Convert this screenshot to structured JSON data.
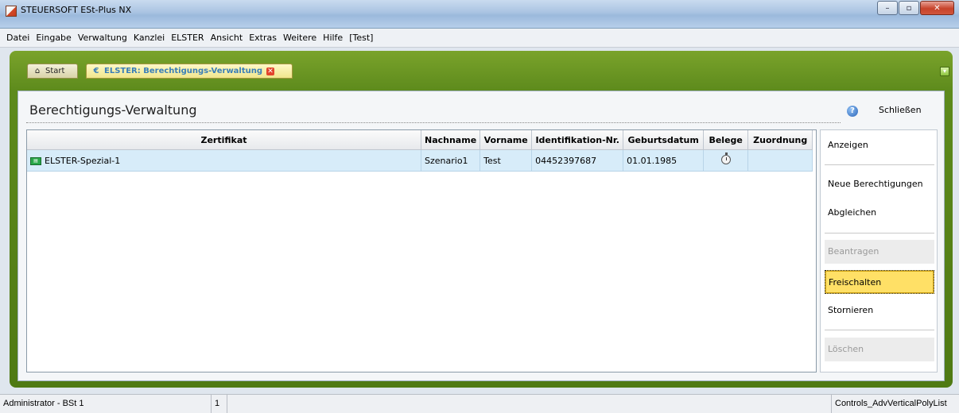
{
  "window": {
    "title": "STEUERSOFT ESt-Plus NX",
    "minimize": "–",
    "maximize": "▫",
    "close": "✕"
  },
  "menu": {
    "items": [
      "Datei",
      "Eingabe",
      "Verwaltung",
      "Kanzlei",
      "ELSTER",
      "Ansicht",
      "Extras",
      "Weitere",
      "Hilfe",
      "[Test]"
    ]
  },
  "tabs": [
    {
      "label": "Start",
      "icon": "start-icon"
    },
    {
      "label": "ELSTER: Berechtigungs-Verwaltung",
      "icon": "elster-icon"
    }
  ],
  "panel": {
    "title": "Berechtigungs-Verwaltung",
    "close_label": "Schließen"
  },
  "table": {
    "columns": [
      "Zertifikat",
      "Nachname",
      "Vorname",
      "Identifikation-Nr.",
      "Geburtsdatum",
      "Belege",
      "Zuordnung"
    ],
    "rows": [
      {
        "zertifikat": "ELSTER-Spezial-1",
        "nachname": "Szenario1",
        "vorname": "Test",
        "identifikation": "04452397687",
        "geburtsdatum": "01.01.1985",
        "belege_icon": "stopwatch-icon",
        "zuordnung": ""
      }
    ]
  },
  "actions": [
    {
      "label": "Anzeigen",
      "state": "enabled"
    },
    {
      "label": "Neue Berechtigungen",
      "state": "enabled"
    },
    {
      "label": "Abgleichen",
      "state": "enabled"
    },
    {
      "label": "Beantragen",
      "state": "disabled"
    },
    {
      "label": "Freischalten",
      "state": "highlighted"
    },
    {
      "label": "Stornieren",
      "state": "enabled"
    },
    {
      "label": "Löschen",
      "state": "disabled"
    }
  ],
  "status": {
    "user": "Administrator - BSt 1",
    "count": "1",
    "control": "Controls_AdvVerticalPolyList"
  },
  "colors": {
    "frame_green": "#5d8a1c",
    "row_selected": "#d7ecf9",
    "highlight_yellow": "#ffe066"
  }
}
